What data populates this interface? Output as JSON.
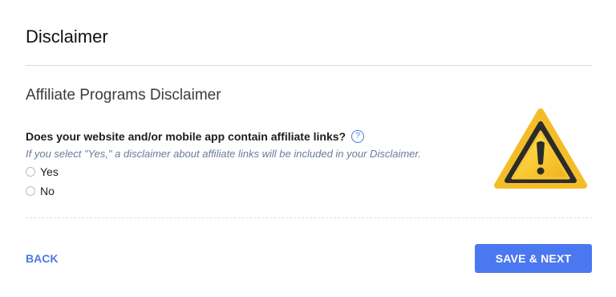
{
  "page": {
    "title": "Disclaimer"
  },
  "section": {
    "title": "Affiliate Programs Disclaimer",
    "question": "Does your website and/or mobile app contain affiliate links?",
    "help_icon_glyph": "?",
    "hint": "If you select \"Yes,\" a disclaimer about affiliate links will be included in your Disclaimer.",
    "options": [
      {
        "label": "Yes",
        "selected": false
      },
      {
        "label": "No",
        "selected": false
      }
    ],
    "illustration": "warning-triangle-icon"
  },
  "footer": {
    "back_label": "BACK",
    "next_label": "SAVE & NEXT"
  },
  "colors": {
    "accent": "#4a78f0",
    "link": "#4a78e6",
    "hint": "#6b7a99",
    "warning_fill": "#f7c531",
    "warning_stroke": "#2a2a2a"
  }
}
